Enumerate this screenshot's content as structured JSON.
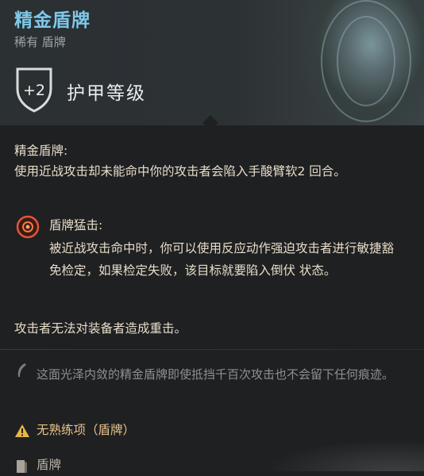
{
  "item": {
    "name": "精金盾牌",
    "rarity_type": "稀有 盾牌",
    "armor_class": {
      "value": "+2",
      "label": "护甲等级"
    }
  },
  "passive": {
    "name": "精金盾牌:",
    "description": "使用近战攻击却未能命中你的攻击者会陷入手酸臂软2 回合。"
  },
  "reaction": {
    "name": "盾牌猛击:",
    "description": "被近战攻击命中时，你可以使用反应动作强迫攻击者进行敏捷豁免检定，如果检定失败，该目标就要陷入倒伏 状态。"
  },
  "crit_immunity": "攻击者无法对装备者造成重击。",
  "flavor": "这面光泽内敛的精金盾牌即使抵挡千百次攻击也不会留下任何痕迹。",
  "proficiency_warning": "无熟练项（盾牌）",
  "item_type": "盾牌",
  "colors": {
    "title": "#7ec8ea",
    "body_text": "#e6dcc8",
    "warning": "#e6c28a",
    "flavor": "#8f9090"
  },
  "icons": {
    "armor_class": "shield-icon",
    "reaction": "reaction-icon",
    "flavor": "quill-icon",
    "warning": "warning-icon",
    "type": "shield-type-icon"
  }
}
